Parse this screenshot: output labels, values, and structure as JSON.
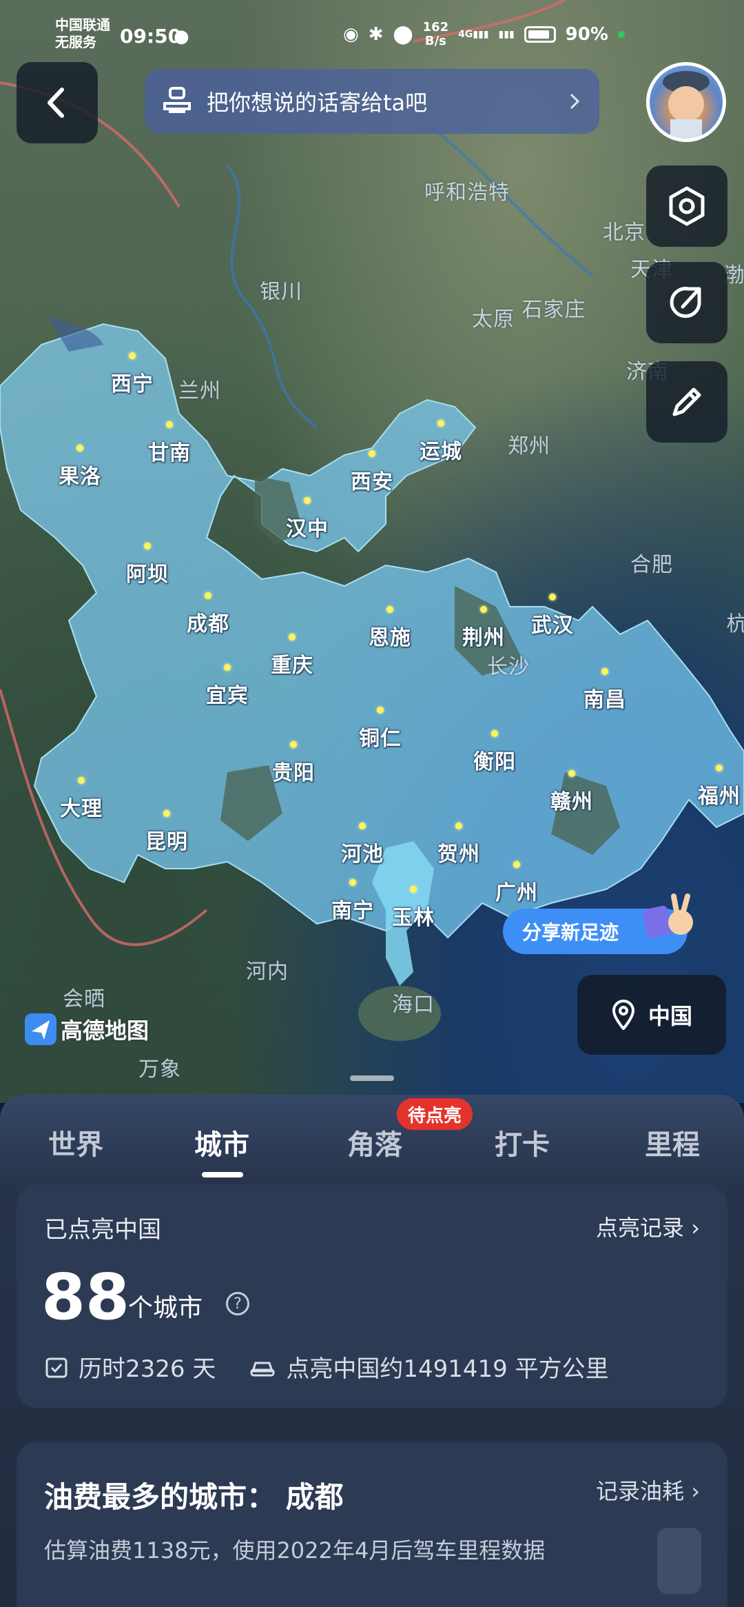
{
  "status_bar": {
    "carrier_line1": "中国联通",
    "carrier_line2": "无服务",
    "time": "09:50",
    "net_speed_value": "162",
    "net_speed_unit": "B/s",
    "network_type": "4G",
    "battery_percent": "90%",
    "battery_level": 0.9
  },
  "header": {
    "message_placeholder": "把你想说的话寄给ta吧"
  },
  "map": {
    "lit_cities": [
      {
        "name": "西宁"
      },
      {
        "name": "甘南"
      },
      {
        "name": "果洛"
      },
      {
        "name": "阿坝"
      },
      {
        "name": "成都"
      },
      {
        "name": "汉中"
      },
      {
        "name": "西安"
      },
      {
        "name": "运城"
      },
      {
        "name": "宜宾"
      },
      {
        "name": "重庆"
      },
      {
        "name": "恩施"
      },
      {
        "name": "荆州"
      },
      {
        "name": "武汉"
      },
      {
        "name": "南昌"
      },
      {
        "name": "铜仁"
      },
      {
        "name": "贵阳"
      },
      {
        "name": "衡阳"
      },
      {
        "name": "赣州"
      },
      {
        "name": "福州"
      },
      {
        "name": "大理"
      },
      {
        "name": "昆明"
      },
      {
        "name": "河池"
      },
      {
        "name": "贺州"
      },
      {
        "name": "南宁"
      },
      {
        "name": "玉林"
      },
      {
        "name": "广州"
      }
    ],
    "other_labels": [
      {
        "name": "呼和浩特"
      },
      {
        "name": "北京"
      },
      {
        "name": "天津"
      },
      {
        "name": "渤"
      },
      {
        "name": "银川"
      },
      {
        "name": "太原"
      },
      {
        "name": "石家庄"
      },
      {
        "name": "济南"
      },
      {
        "name": "兰州"
      },
      {
        "name": "郑州"
      },
      {
        "name": "合肥"
      },
      {
        "name": "杭"
      },
      {
        "name": "长沙"
      },
      {
        "name": "河内"
      },
      {
        "name": "会晒"
      },
      {
        "name": "海口"
      },
      {
        "name": "万象"
      }
    ],
    "share_button_label": "分享新足迹",
    "region_button_label": "中国",
    "logo_text": "高德地图"
  },
  "tabs": {
    "items": [
      "世界",
      "城市",
      "角落",
      "打卡",
      "里程"
    ],
    "active": "城市",
    "badge": "待点亮"
  },
  "summary_card": {
    "title": "已点亮中国",
    "link": "点亮记录",
    "count": "88",
    "unit": "个城市",
    "help_icon": "?",
    "duration_text": "历时2326 天",
    "area_text": "点亮中国约1491419 平方公里"
  },
  "fuel_card": {
    "title": "油费最多的城市：  成都",
    "link": "记录油耗",
    "subtitle": "估算油费1138元，使用2022年4月后驾车里程数据"
  }
}
